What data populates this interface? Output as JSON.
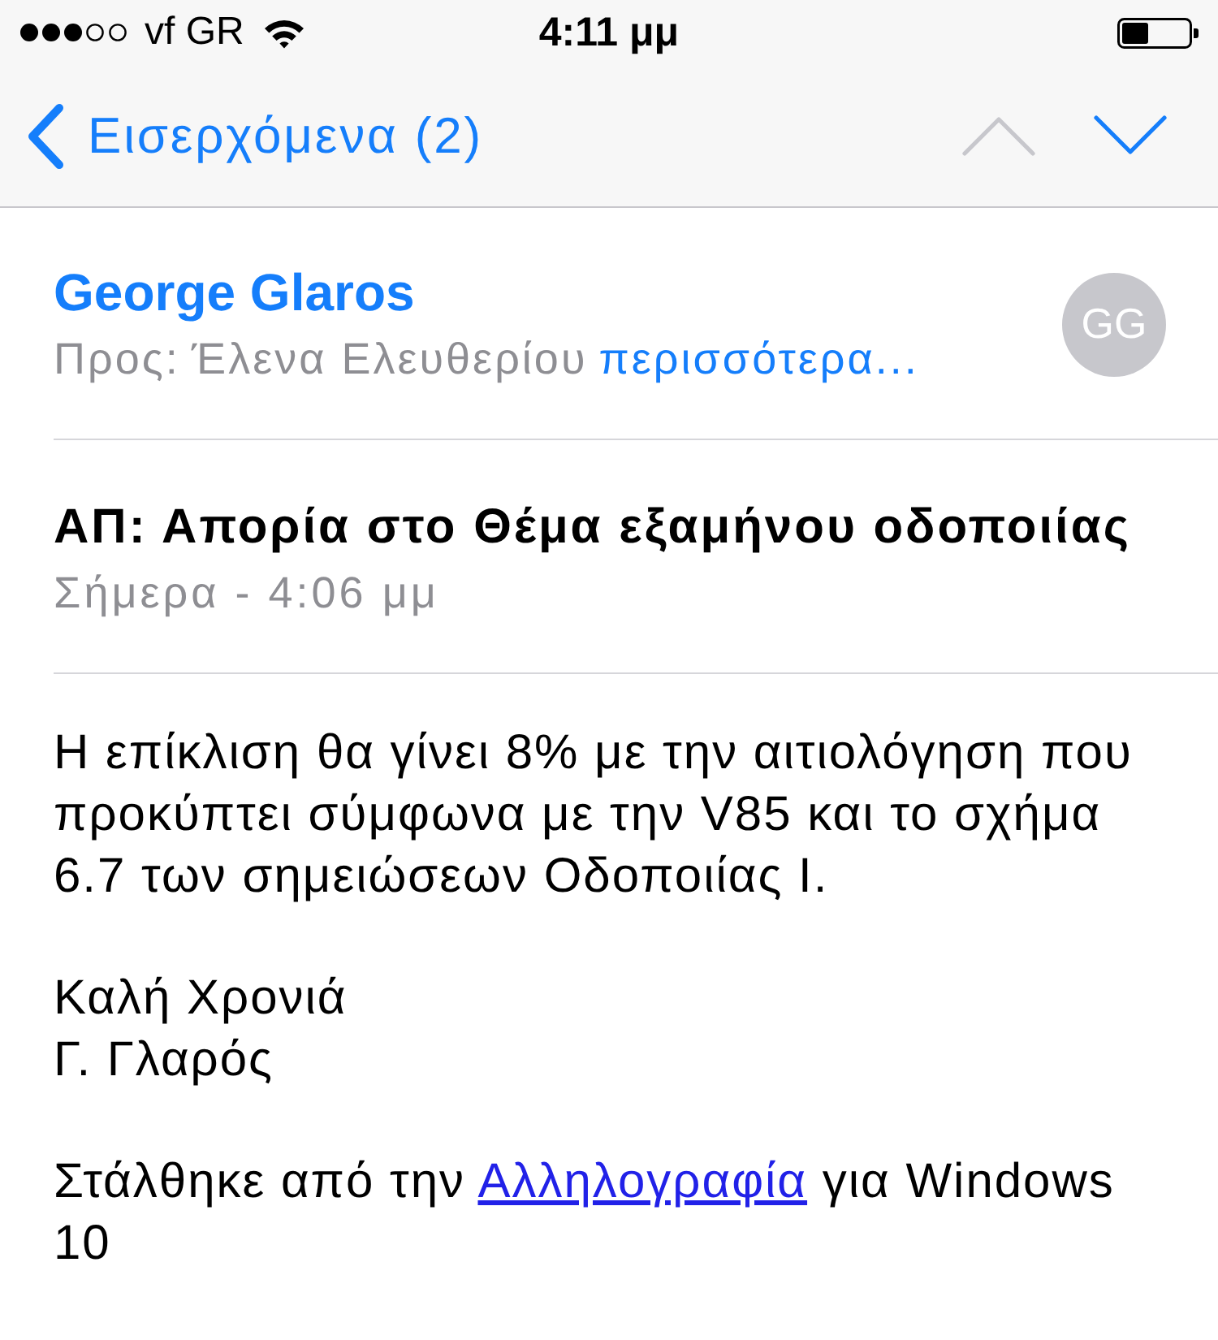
{
  "status_bar": {
    "carrier": "vf GR",
    "time": "4:11 μμ"
  },
  "nav_bar": {
    "back_label": "Εισερχόμενα (2)",
    "previous": {
      "disabled": true
    },
    "next": {
      "disabled": false
    }
  },
  "header": {
    "sender": "George Glaros",
    "to_label": "Προς:",
    "recipient": "Έλενα Ελευθερίου",
    "more_link": "περισσότερα...",
    "avatar_initials": "GG"
  },
  "message": {
    "subject": "ΑΠ: Απορία στο Θέμα εξαμήνου οδοποιίας",
    "date": "Σήμερα - 4:06 μμ"
  },
  "body": {
    "paragraph": "Η επίκλιση θα γίνει 8% με την αιτιολόγηση που προκύπτει σύμφωνα με την V85 και το σχήμα 6.7 των σημειώσεων Οδοποιίας Ι.",
    "signature_lines": [
      "Καλή Χρονιά",
      "Γ. Γλαρός"
    ],
    "footer": {
      "before": "Στάλθηκε από την",
      "link": "Αλληλογραφία",
      "after": "για Windows 10"
    }
  }
}
